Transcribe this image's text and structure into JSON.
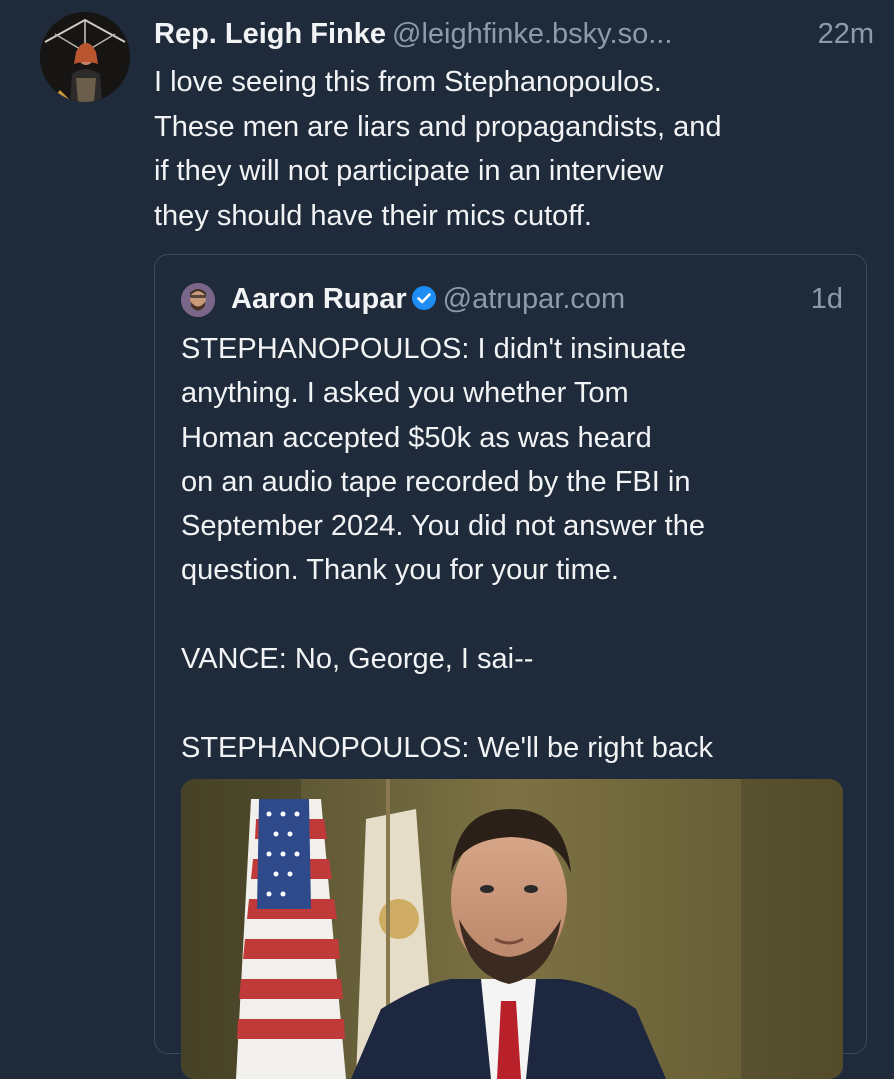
{
  "post": {
    "author": {
      "name": "Rep. Leigh Finke",
      "handle": "@leighfinke.bsky.so..."
    },
    "time": "22m",
    "text": "I love seeing this from Stephanopoulos.\nThese men are liars and propagandists, and\nif they will not participate in an interview\nthey should have their mics cutoff."
  },
  "quote": {
    "author": {
      "name": "Aaron Rupar",
      "handle": "@atrupar.com",
      "verified": true
    },
    "time": "1d",
    "text": "STEPHANOPOULOS: I didn't insinuate\nanything. I asked you whether Tom\nHoman accepted $50k as was heard\non an audio tape recorded by the FBI in\nSeptember 2024. You did not answer the\nquestion. Thank you for your time.\n\nVANCE: No, George, I sai--\n\nSTEPHANOPOULOS: We'll be right back"
  },
  "icons": {
    "verified": "verified-badge-icon"
  },
  "colors": {
    "background": "#1f2b3a",
    "text": "#f1f3f5",
    "muted": "#8c9bab",
    "verified": "#1d8cf5",
    "border": "#3a4b5e"
  }
}
